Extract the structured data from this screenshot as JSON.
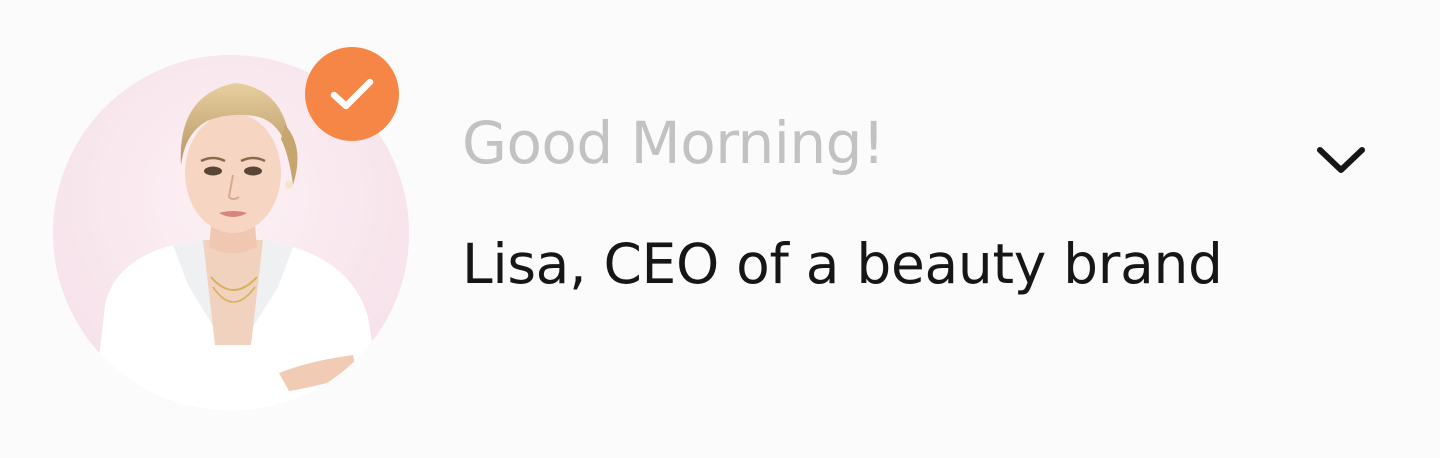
{
  "header": {
    "greeting": "Good Morning!",
    "user_title": "Lisa, CEO of a beauty brand",
    "avatar_icon": "user-photo",
    "badge_icon": "checkmark-icon",
    "dropdown_icon": "chevron-down-icon"
  },
  "colors": {
    "background": "#fbfbfb",
    "avatar_background": "#f9e7ee",
    "badge": "#f58646",
    "greeting_text": "#c2c2c2",
    "title_text": "#161616",
    "chevron": "#161616"
  }
}
